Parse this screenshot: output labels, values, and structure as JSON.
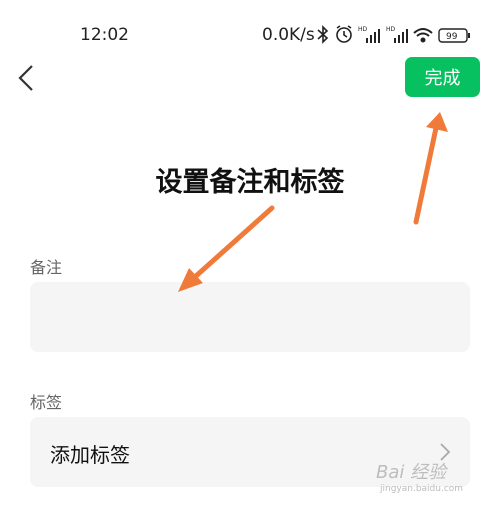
{
  "status_bar": {
    "time": "12:02",
    "network_speed": "0.0K/s",
    "battery": "99",
    "icons": [
      "bluetooth-icon",
      "alarm-icon",
      "signal-icon",
      "signal-icon",
      "wifi-icon",
      "battery-icon"
    ]
  },
  "header": {
    "back_icon": "chevron-left-icon",
    "done_label": "完成"
  },
  "annotation": {
    "title": "设置备注和标签"
  },
  "remark": {
    "label": "备注",
    "value": ""
  },
  "tags": {
    "label": "标签",
    "add_label": "添加标签"
  },
  "watermark": {
    "text": "Bai 经验",
    "url": "jingyan.baidu.com"
  },
  "colors": {
    "accent": "#07c160",
    "arrow": "#f07a3a",
    "field_bg": "#f5f5f5"
  }
}
